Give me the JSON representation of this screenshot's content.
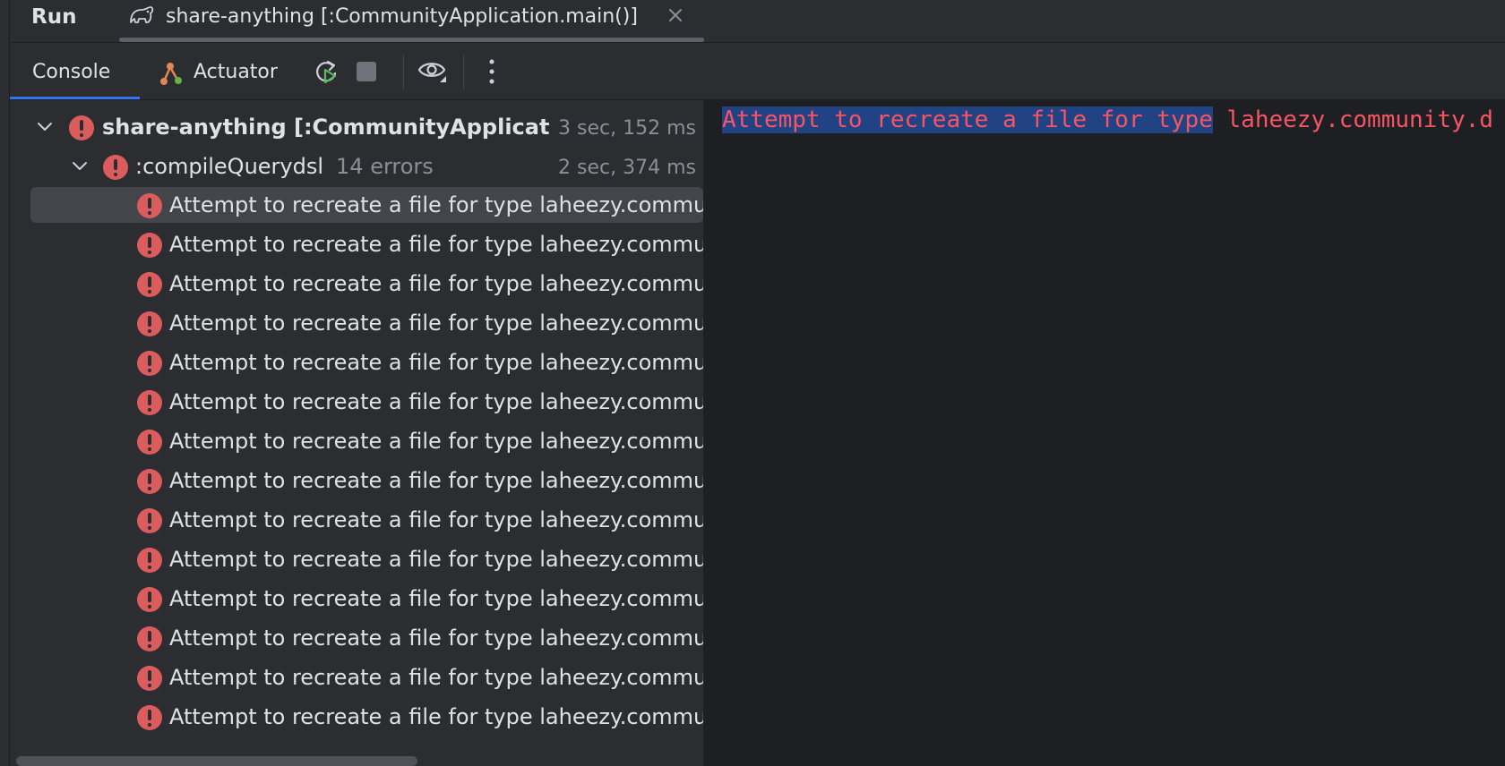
{
  "colors": {
    "panel_bg": "#2b2d30",
    "console_bg": "#1e1f22",
    "error_red": "#db5c5c",
    "console_error_text": "#f75464",
    "selection_bg": "#214283",
    "accent_blue": "#3574f0"
  },
  "run_bar": {
    "label": "Run",
    "tab": {
      "icon": "gradle-elephant-icon",
      "title": "share-anything [:CommunityApplication.main()]",
      "close_icon": "close-icon"
    }
  },
  "toolbar": {
    "tabs": [
      {
        "label": "Console",
        "active": true
      },
      {
        "label": "Actuator",
        "icon": "actuator-icon",
        "active": false
      }
    ],
    "buttons": [
      {
        "name": "rerun-button",
        "icon": "rerun-icon"
      },
      {
        "name": "stop-button",
        "icon": "stop-icon",
        "enabled": false
      },
      {
        "name": "view-options-button",
        "icon": "eye-icon"
      },
      {
        "name": "more-button",
        "icon": "more-vertical-icon"
      }
    ]
  },
  "tree": {
    "root": {
      "label": "share-anything [:CommunityApplication.main()]",
      "duration": "3 sec, 152 ms",
      "status": "error",
      "expanded": true
    },
    "task": {
      "label": ":compileQuerydsl",
      "count": "14 errors",
      "duration": "2 sec, 374 ms",
      "status": "error",
      "expanded": true
    },
    "items": [
      "Attempt to recreate a file for type laheezy.community.d",
      "Attempt to recreate a file for type laheezy.community.d",
      "Attempt to recreate a file for type laheezy.community.d",
      "Attempt to recreate a file for type laheezy.community.d",
      "Attempt to recreate a file for type laheezy.community.d",
      "Attempt to recreate a file for type laheezy.community.d",
      "Attempt to recreate a file for type laheezy.community.d",
      "Attempt to recreate a file for type laheezy.community.d",
      "Attempt to recreate a file for type laheezy.community.d",
      "Attempt to recreate a file for type laheezy.community.d",
      "Attempt to recreate a file for type laheezy.community.d",
      "Attempt to recreate a file for type laheezy.community.d",
      "Attempt to recreate a file for type laheezy.community.d",
      "Attempt to recreate a file for type laheezy.community.d"
    ],
    "selected_index": 0
  },
  "console": {
    "selected_text": "Attempt to recreate a file for type",
    "rest_text": " laheezy.community.d"
  }
}
